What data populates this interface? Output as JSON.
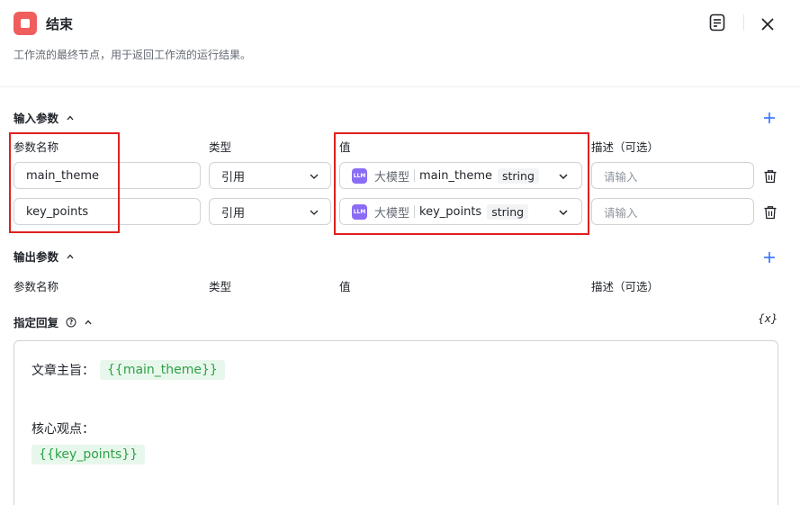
{
  "header": {
    "title": "结束",
    "description": "工作流的最终节点，用于返回工作流的运行结果。",
    "icon": "stop-square-icon",
    "icon_color": "#f05d5d"
  },
  "input_section": {
    "title": "输入参数",
    "columns": {
      "name": "参数名称",
      "type": "类型",
      "value": "值",
      "description": "描述（可选）"
    },
    "rows": [
      {
        "name": "main_theme",
        "type": "引用",
        "source": "大模型",
        "source_icon_text": "LLM",
        "variable": "main_theme",
        "var_type": "string",
        "description_placeholder": "请输入"
      },
      {
        "name": "key_points",
        "type": "引用",
        "source": "大模型",
        "source_icon_text": "LLM",
        "variable": "key_points",
        "var_type": "string",
        "description_placeholder": "请输入"
      }
    ]
  },
  "output_section": {
    "title": "输出参数",
    "columns": {
      "name": "参数名称",
      "type": "类型",
      "value": "值",
      "description": "描述（可选）"
    }
  },
  "reply_section": {
    "title": "指定回复",
    "var_button": "{x}",
    "lines": [
      {
        "label": "文章主旨：",
        "chip": "{{main_theme}}"
      },
      {
        "label": "核心观点：",
        "chip": "{{key_points}}"
      }
    ]
  },
  "colors": {
    "accent": "#3370ff",
    "highlight_border": "#e0201f",
    "chip_bg": "#e8f7ec",
    "chip_text": "#2ea145",
    "llm_badge": "#8b6cf5"
  }
}
